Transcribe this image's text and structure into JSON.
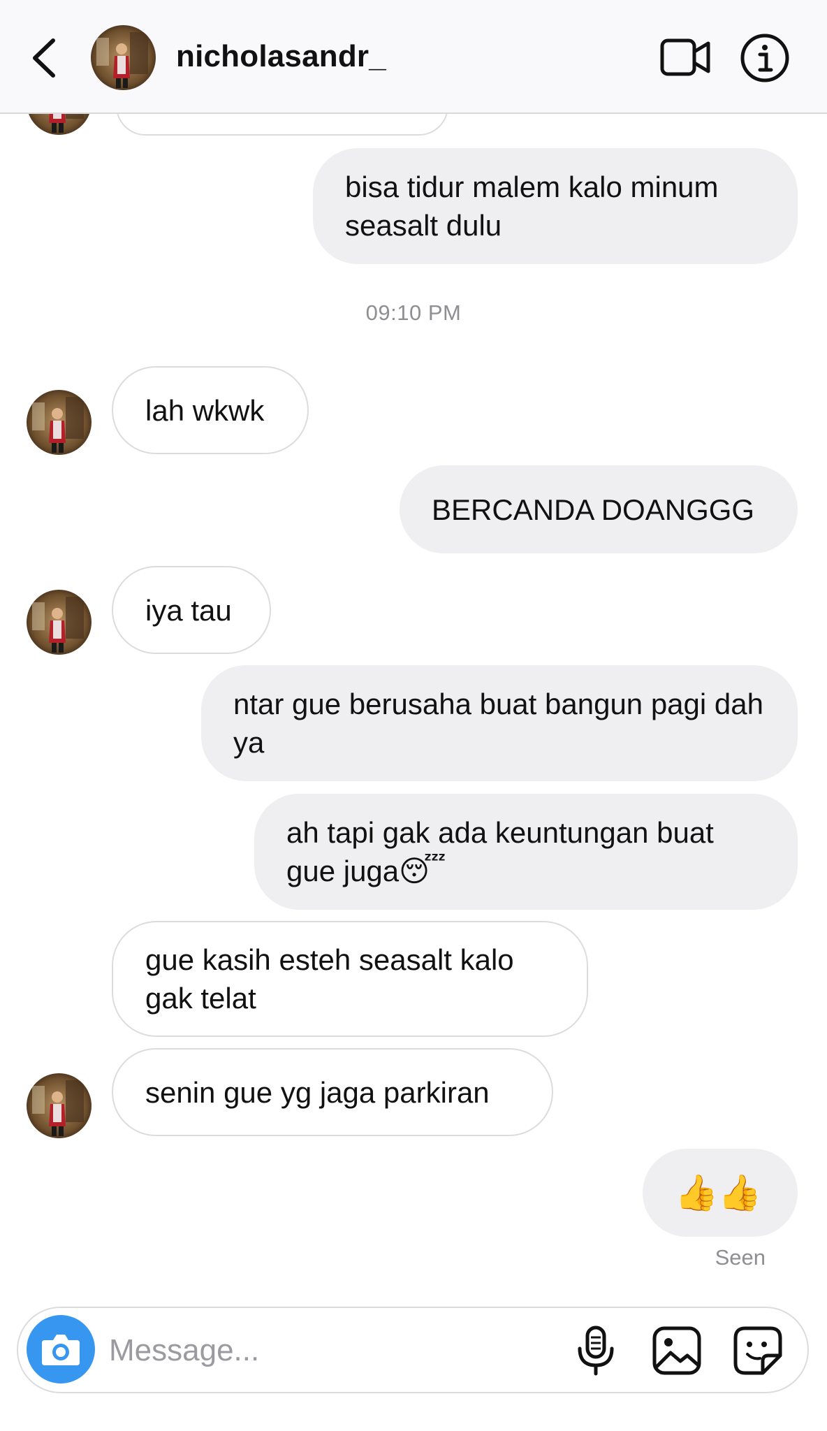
{
  "header": {
    "username": "nicholasandr_"
  },
  "messages": [
    {
      "id": "m1",
      "side": "outgoing",
      "text": "bisa tidur malem kalo minum seasalt dulu"
    },
    {
      "id": "m2",
      "side": "incoming",
      "text": "lah wkwk"
    },
    {
      "id": "m3",
      "side": "outgoing",
      "text": "BERCANDA DOANGGG"
    },
    {
      "id": "m4",
      "side": "incoming",
      "text": "iya tau"
    },
    {
      "id": "m5",
      "side": "outgoing",
      "text": "ntar gue berusaha buat bangun pagi dah ya"
    },
    {
      "id": "m6",
      "side": "outgoing",
      "text": "ah tapi gak ada keuntungan buat gue juga😴"
    },
    {
      "id": "m7",
      "side": "incoming",
      "text": "gue kasih esteh seasalt kalo gak telat"
    },
    {
      "id": "m8",
      "side": "incoming",
      "text": "senin gue yg jaga parkiran"
    },
    {
      "id": "m9",
      "side": "outgoing",
      "text": "👍👍"
    }
  ],
  "timestamp": "09:10 PM",
  "seen_label": "Seen",
  "composer": {
    "placeholder": "Message..."
  },
  "colors": {
    "accent": "#3797f0",
    "outgoing_bubble": "#efeff1",
    "incoming_border": "#dcdcdf",
    "meta_text": "#8e8e93"
  },
  "icons": [
    "back-chevron-icon",
    "video-call-icon",
    "info-icon",
    "camera-icon",
    "microphone-icon",
    "gallery-icon",
    "sticker-icon"
  ]
}
